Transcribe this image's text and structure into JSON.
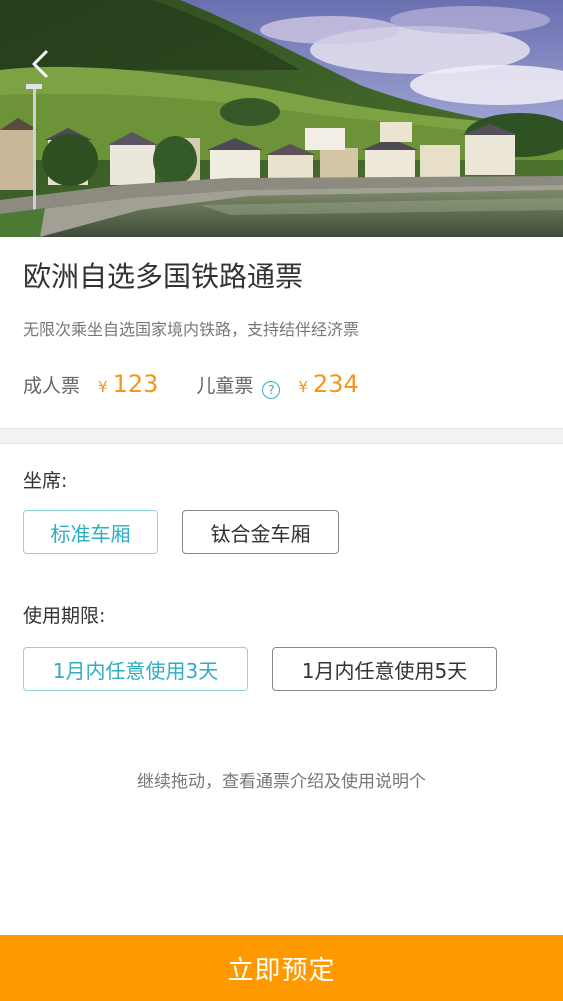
{
  "header": {
    "back_icon": "chevron-left-icon"
  },
  "product": {
    "title": "欧洲自选多国铁路通票",
    "subtitle": "无限次乘坐自选国家境内铁路，支持结伴经济票",
    "adult_label": "成人票",
    "adult_currency": "¥",
    "adult_price": "123",
    "child_label": "儿童票",
    "child_help_icon": "question-circle-icon",
    "child_help_glyph": "?",
    "child_currency": "¥",
    "child_price": "234"
  },
  "seat": {
    "label": "坐席:",
    "options": [
      {
        "label": "标准车厢",
        "selected": true
      },
      {
        "label": "钛合金车厢",
        "selected": false
      }
    ]
  },
  "validity": {
    "label": "使用期限:",
    "options": [
      {
        "label": "1月内任意使用3天",
        "selected": true
      },
      {
        "label": "1月内任意使用5天",
        "selected": false
      }
    ]
  },
  "drag_hint": "继续拖动，查看通票介绍及使用说明个",
  "book_button": "立即预定",
  "colors": {
    "accent": "#2eb2c5",
    "price": "#f7941d",
    "cta": "#ff9900"
  }
}
